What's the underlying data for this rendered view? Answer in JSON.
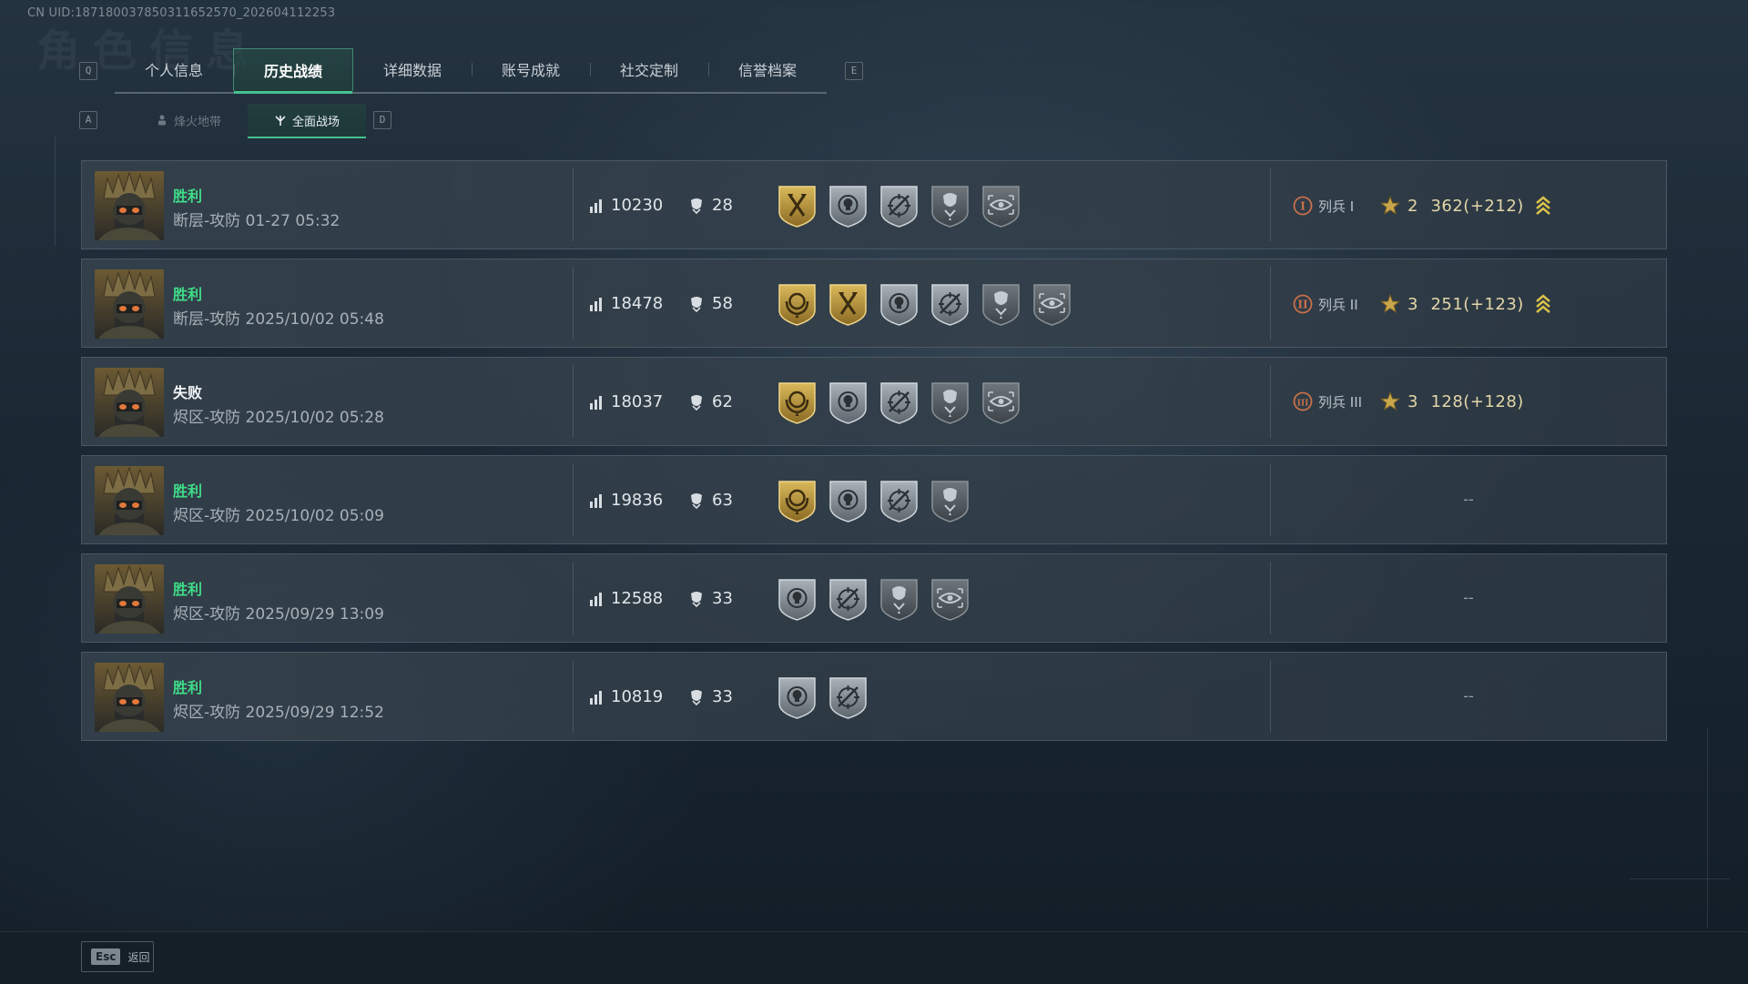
{
  "uid_text": "CN UID:187180037850311652570_202604112253",
  "bg_title": "角色信息",
  "key_hints": {
    "tab_prev": "Q",
    "tab_next": "E",
    "sub_prev": "A",
    "sub_next": "D"
  },
  "tabs": [
    {
      "label": "个人信息",
      "active": false
    },
    {
      "label": "历史战绩",
      "active": true
    },
    {
      "label": "详细数据",
      "active": false
    },
    {
      "label": "账号成就",
      "active": false
    },
    {
      "label": "社交定制",
      "active": false
    },
    {
      "label": "信誉档案",
      "active": false
    }
  ],
  "subtabs": [
    {
      "label": "烽火地带",
      "icon": "person-icon",
      "active": false
    },
    {
      "label": "全面战场",
      "icon": "crossed-arms-icon",
      "active": true
    }
  ],
  "colors": {
    "win": "#3fdc88",
    "accent": "#45c08f",
    "gold": "#c9a64a"
  },
  "matches": [
    {
      "result": "胜利",
      "win": true,
      "map_date": "断层-攻防 01-27 05:32",
      "score": "10230",
      "kills": "28",
      "badges": [
        "gold-axes",
        "silver-skull",
        "silver-crosshair",
        "dark-skull",
        "dark-eye"
      ],
      "rank": {
        "numeral": "I",
        "name": "列兵 I",
        "stars": "2",
        "points": "362(+212)",
        "promo": true
      }
    },
    {
      "result": "胜利",
      "win": true,
      "map_date": "断层-攻防 2025/10/02 05:48",
      "score": "18478",
      "kills": "58",
      "badges": [
        "gold-wreath",
        "gold-axes",
        "silver-skull",
        "silver-crosshair",
        "dark-skull",
        "dark-eye"
      ],
      "rank": {
        "numeral": "II",
        "name": "列兵 II",
        "stars": "3",
        "points": "251(+123)",
        "promo": true
      }
    },
    {
      "result": "失败",
      "win": false,
      "map_date": "烬区-攻防 2025/10/02 05:28",
      "score": "18037",
      "kills": "62",
      "badges": [
        "gold-wreath",
        "silver-skull",
        "silver-crosshair",
        "dark-skull",
        "dark-eye"
      ],
      "rank": {
        "numeral": "III",
        "name": "列兵 III",
        "stars": "3",
        "points": "128(+128)",
        "promo": false
      }
    },
    {
      "result": "胜利",
      "win": true,
      "map_date": "烬区-攻防 2025/10/02 05:09",
      "score": "19836",
      "kills": "63",
      "badges": [
        "gold-wreath",
        "silver-skull",
        "silver-crosshair",
        "dark-skull"
      ],
      "rank": null,
      "empty_rank": "--"
    },
    {
      "result": "胜利",
      "win": true,
      "map_date": "烬区-攻防 2025/09/29 13:09",
      "score": "12588",
      "kills": "33",
      "badges": [
        "silver-skull",
        "silver-crosshair",
        "dark-skull",
        "dark-eye"
      ],
      "rank": null,
      "empty_rank": "--"
    },
    {
      "result": "胜利",
      "win": true,
      "map_date": "烬区-攻防 2025/09/29 12:52",
      "score": "10819",
      "kills": "33",
      "badges": [
        "silver-skull",
        "silver-crosshair"
      ],
      "rank": null,
      "empty_rank": "--"
    }
  ],
  "footer": {
    "esc_key": "Esc",
    "esc_label": "返回"
  }
}
